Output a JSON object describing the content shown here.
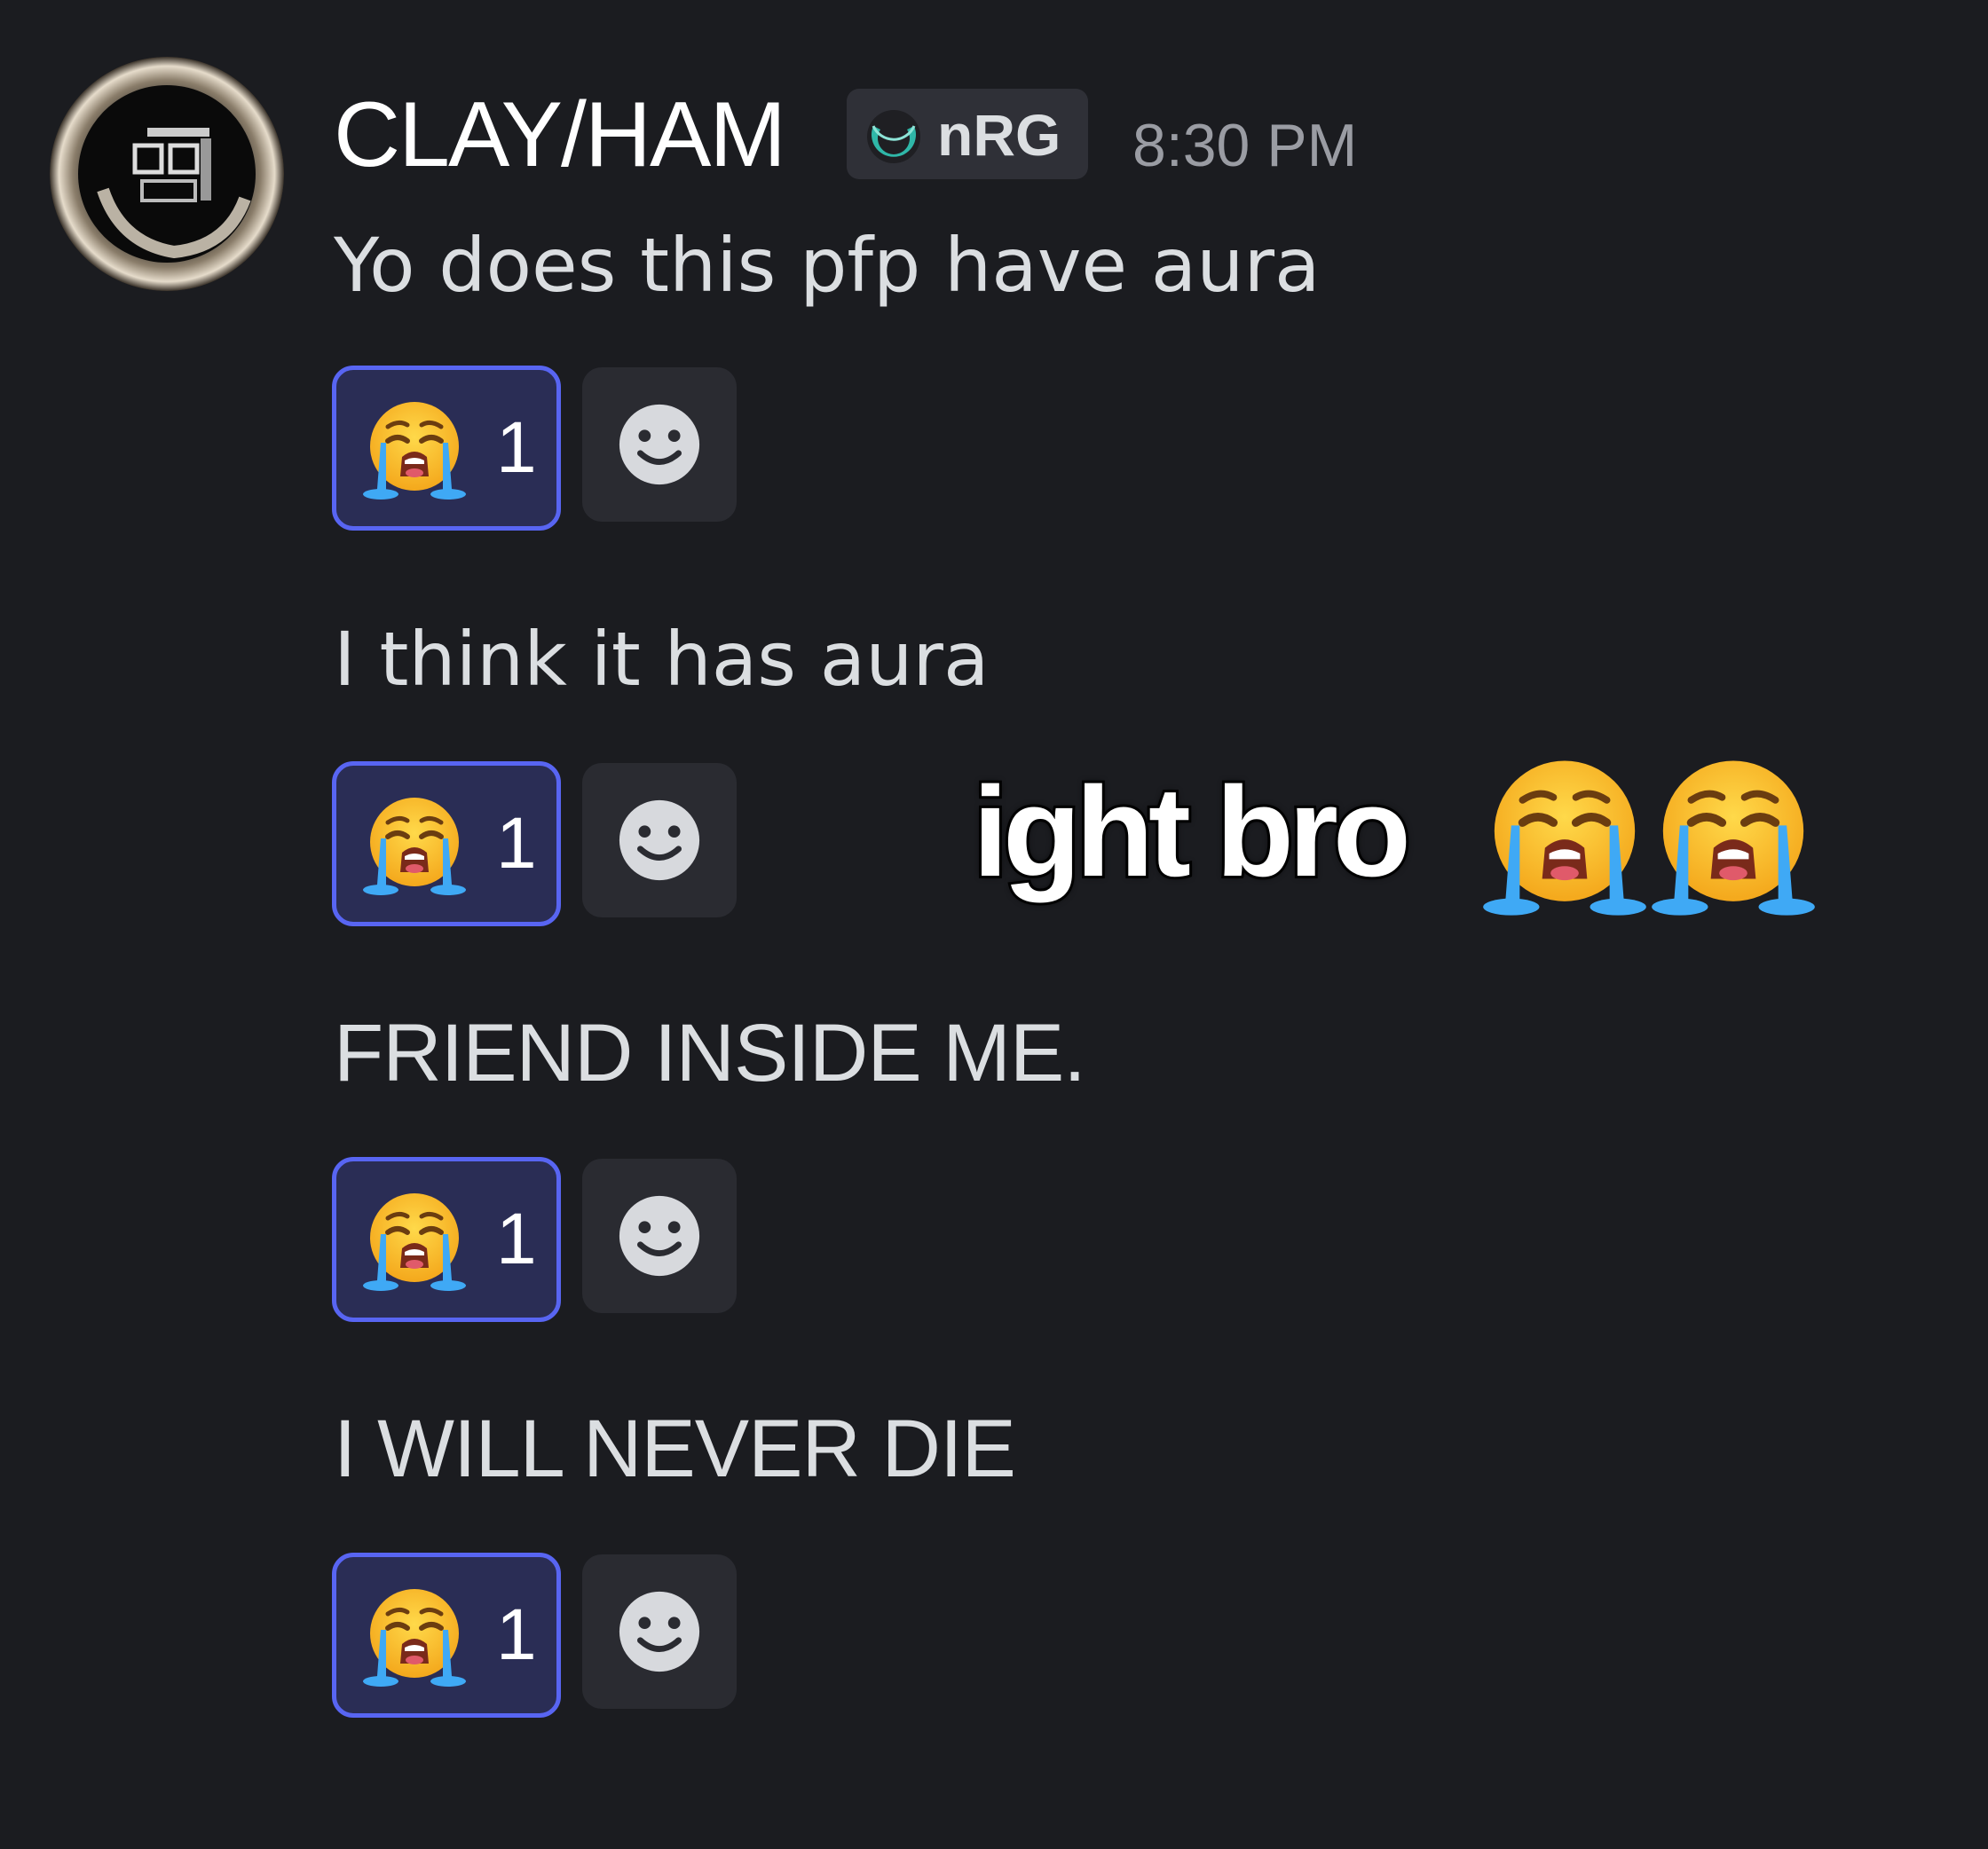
{
  "message_group": {
    "username": "CLAY/HAM",
    "guild_tag": "nRG",
    "timestamp": "8:30 PM"
  },
  "messages": [
    {
      "text": "Yo does this pfp have aura",
      "reaction": {
        "emoji": "loudly-crying-face",
        "count": "1"
      }
    },
    {
      "text": "I think it has aura",
      "reaction": {
        "emoji": "loudly-crying-face",
        "count": "1"
      }
    },
    {
      "text": "FRIEND INSIDE ME.",
      "reaction": {
        "emoji": "loudly-crying-face",
        "count": "1"
      }
    },
    {
      "text": "I WILL NEVER DIE",
      "reaction": {
        "emoji": "loudly-crying-face",
        "count": "1"
      }
    }
  ],
  "overlay_caption": {
    "text": "ight bro",
    "emojis": [
      "loudly-crying-face",
      "loudly-crying-face"
    ]
  },
  "colors": {
    "background": "#1b1c20",
    "reaction_active_border": "#5865f2",
    "reaction_active_bg": "#2a2d55",
    "add_reaction_bg": "#2a2b31",
    "tag_bg": "#2f3037",
    "tag_icon": "#2fb7a8",
    "timestamp": "#9a9ca3",
    "message_text": "#dbdee1"
  },
  "icons": {
    "add_reaction": "smiley-add-reaction-icon",
    "guild_tag": "crescent-guild-icon"
  }
}
